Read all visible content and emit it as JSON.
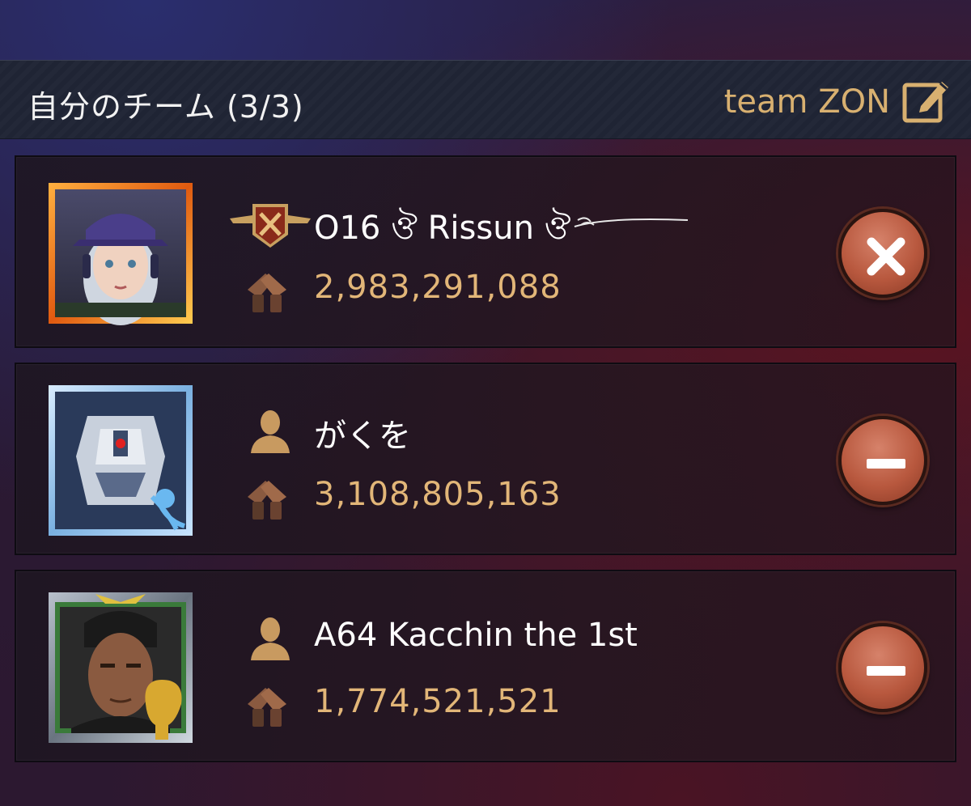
{
  "header": {
    "title": "自分のチーム (3/3)",
    "team_name": "team ZON",
    "edit_icon": "edit-pencil-icon"
  },
  "members": [
    {
      "name": "O16 ঔ Rissun ঔ",
      "power": "2,983,291,088",
      "badge": "rank-crossed-guns-badge-icon",
      "action": "remove-x-icon",
      "avatar": "female-soldier-avatar",
      "frame_color": "#e07020"
    },
    {
      "name": "がくを",
      "power": "3,108,805,163",
      "badge": "person-silhouette-icon",
      "action": "minus-icon",
      "avatar": "mech-robot-avatar",
      "frame_color": "#9cc8ee"
    },
    {
      "name": "A64 Kacchin the 1st",
      "power": "1,774,521,521",
      "badge": "person-silhouette-icon",
      "action": "minus-icon",
      "avatar": "male-soldier-avatar",
      "frame_color": "#7a9a70"
    }
  ],
  "colors": {
    "gold_text": "#e2b678",
    "team_name": "#d8b070",
    "button": "#c0654a"
  }
}
